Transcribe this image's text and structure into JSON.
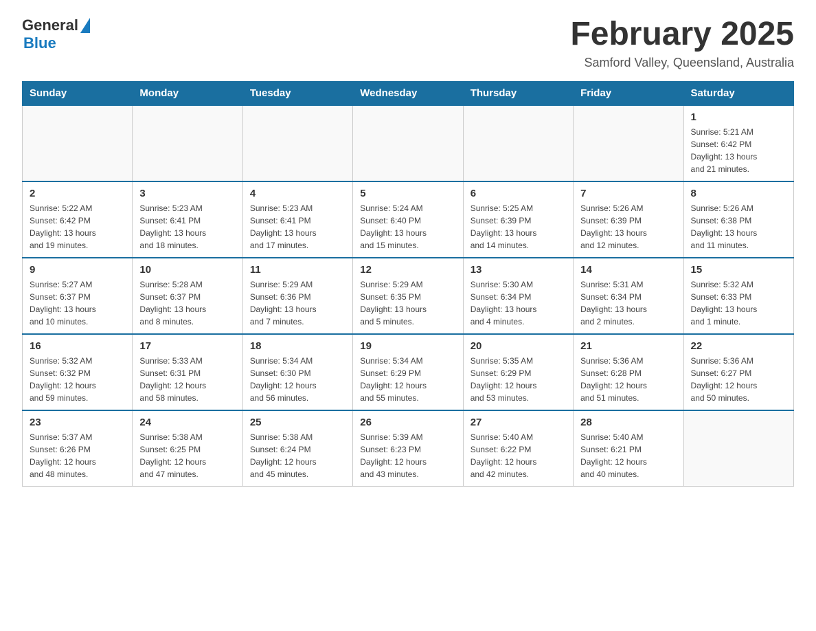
{
  "header": {
    "logo_general": "General",
    "logo_blue": "Blue",
    "month_title": "February 2025",
    "location": "Samford Valley, Queensland, Australia"
  },
  "days_of_week": [
    "Sunday",
    "Monday",
    "Tuesday",
    "Wednesday",
    "Thursday",
    "Friday",
    "Saturday"
  ],
  "weeks": [
    {
      "days": [
        {
          "num": "",
          "info": ""
        },
        {
          "num": "",
          "info": ""
        },
        {
          "num": "",
          "info": ""
        },
        {
          "num": "",
          "info": ""
        },
        {
          "num": "",
          "info": ""
        },
        {
          "num": "",
          "info": ""
        },
        {
          "num": "1",
          "info": "Sunrise: 5:21 AM\nSunset: 6:42 PM\nDaylight: 13 hours\nand 21 minutes."
        }
      ]
    },
    {
      "days": [
        {
          "num": "2",
          "info": "Sunrise: 5:22 AM\nSunset: 6:42 PM\nDaylight: 13 hours\nand 19 minutes."
        },
        {
          "num": "3",
          "info": "Sunrise: 5:23 AM\nSunset: 6:41 PM\nDaylight: 13 hours\nand 18 minutes."
        },
        {
          "num": "4",
          "info": "Sunrise: 5:23 AM\nSunset: 6:41 PM\nDaylight: 13 hours\nand 17 minutes."
        },
        {
          "num": "5",
          "info": "Sunrise: 5:24 AM\nSunset: 6:40 PM\nDaylight: 13 hours\nand 15 minutes."
        },
        {
          "num": "6",
          "info": "Sunrise: 5:25 AM\nSunset: 6:39 PM\nDaylight: 13 hours\nand 14 minutes."
        },
        {
          "num": "7",
          "info": "Sunrise: 5:26 AM\nSunset: 6:39 PM\nDaylight: 13 hours\nand 12 minutes."
        },
        {
          "num": "8",
          "info": "Sunrise: 5:26 AM\nSunset: 6:38 PM\nDaylight: 13 hours\nand 11 minutes."
        }
      ]
    },
    {
      "days": [
        {
          "num": "9",
          "info": "Sunrise: 5:27 AM\nSunset: 6:37 PM\nDaylight: 13 hours\nand 10 minutes."
        },
        {
          "num": "10",
          "info": "Sunrise: 5:28 AM\nSunset: 6:37 PM\nDaylight: 13 hours\nand 8 minutes."
        },
        {
          "num": "11",
          "info": "Sunrise: 5:29 AM\nSunset: 6:36 PM\nDaylight: 13 hours\nand 7 minutes."
        },
        {
          "num": "12",
          "info": "Sunrise: 5:29 AM\nSunset: 6:35 PM\nDaylight: 13 hours\nand 5 minutes."
        },
        {
          "num": "13",
          "info": "Sunrise: 5:30 AM\nSunset: 6:34 PM\nDaylight: 13 hours\nand 4 minutes."
        },
        {
          "num": "14",
          "info": "Sunrise: 5:31 AM\nSunset: 6:34 PM\nDaylight: 13 hours\nand 2 minutes."
        },
        {
          "num": "15",
          "info": "Sunrise: 5:32 AM\nSunset: 6:33 PM\nDaylight: 13 hours\nand 1 minute."
        }
      ]
    },
    {
      "days": [
        {
          "num": "16",
          "info": "Sunrise: 5:32 AM\nSunset: 6:32 PM\nDaylight: 12 hours\nand 59 minutes."
        },
        {
          "num": "17",
          "info": "Sunrise: 5:33 AM\nSunset: 6:31 PM\nDaylight: 12 hours\nand 58 minutes."
        },
        {
          "num": "18",
          "info": "Sunrise: 5:34 AM\nSunset: 6:30 PM\nDaylight: 12 hours\nand 56 minutes."
        },
        {
          "num": "19",
          "info": "Sunrise: 5:34 AM\nSunset: 6:29 PM\nDaylight: 12 hours\nand 55 minutes."
        },
        {
          "num": "20",
          "info": "Sunrise: 5:35 AM\nSunset: 6:29 PM\nDaylight: 12 hours\nand 53 minutes."
        },
        {
          "num": "21",
          "info": "Sunrise: 5:36 AM\nSunset: 6:28 PM\nDaylight: 12 hours\nand 51 minutes."
        },
        {
          "num": "22",
          "info": "Sunrise: 5:36 AM\nSunset: 6:27 PM\nDaylight: 12 hours\nand 50 minutes."
        }
      ]
    },
    {
      "days": [
        {
          "num": "23",
          "info": "Sunrise: 5:37 AM\nSunset: 6:26 PM\nDaylight: 12 hours\nand 48 minutes."
        },
        {
          "num": "24",
          "info": "Sunrise: 5:38 AM\nSunset: 6:25 PM\nDaylight: 12 hours\nand 47 minutes."
        },
        {
          "num": "25",
          "info": "Sunrise: 5:38 AM\nSunset: 6:24 PM\nDaylight: 12 hours\nand 45 minutes."
        },
        {
          "num": "26",
          "info": "Sunrise: 5:39 AM\nSunset: 6:23 PM\nDaylight: 12 hours\nand 43 minutes."
        },
        {
          "num": "27",
          "info": "Sunrise: 5:40 AM\nSunset: 6:22 PM\nDaylight: 12 hours\nand 42 minutes."
        },
        {
          "num": "28",
          "info": "Sunrise: 5:40 AM\nSunset: 6:21 PM\nDaylight: 12 hours\nand 40 minutes."
        },
        {
          "num": "",
          "info": ""
        }
      ]
    }
  ]
}
